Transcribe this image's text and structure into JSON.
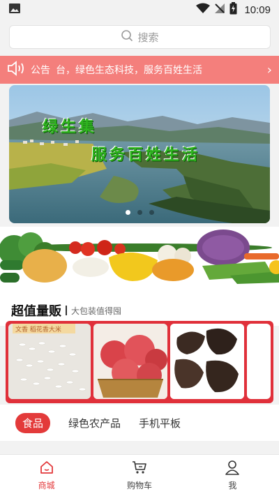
{
  "status_bar": {
    "time": "10:09"
  },
  "search": {
    "placeholder": "搜索"
  },
  "notice": {
    "label": "公告",
    "text": "台，绿色生态科技，服务百姓生活"
  },
  "banner": {
    "line1": "绿生集",
    "line2": "服务百姓生活",
    "slide_count": 3,
    "active_slide": 1
  },
  "section": {
    "title": "超值量贩",
    "subtitle": "大包装值得囤"
  },
  "deal_cards": [
    {
      "icon": "rice-product-image",
      "tag": "文香 稻花香大米"
    },
    {
      "icon": "apple-product-image"
    },
    {
      "icon": "mushroom-product-image"
    }
  ],
  "categories": [
    {
      "label": "食品",
      "active": true
    },
    {
      "label": "绿色农产品",
      "active": false
    },
    {
      "label": "手机平板",
      "active": false
    }
  ],
  "nav": [
    {
      "label": "商城",
      "icon": "home-icon",
      "active": true
    },
    {
      "label": "购物车",
      "icon": "cart-icon",
      "active": false
    },
    {
      "label": "我",
      "icon": "user-icon",
      "active": false
    }
  ],
  "colors": {
    "notice_bg": "#f47f7c",
    "accent": "#e33a3a",
    "deal_bg": "#e0303a",
    "banner_text": "#2fb51f"
  }
}
